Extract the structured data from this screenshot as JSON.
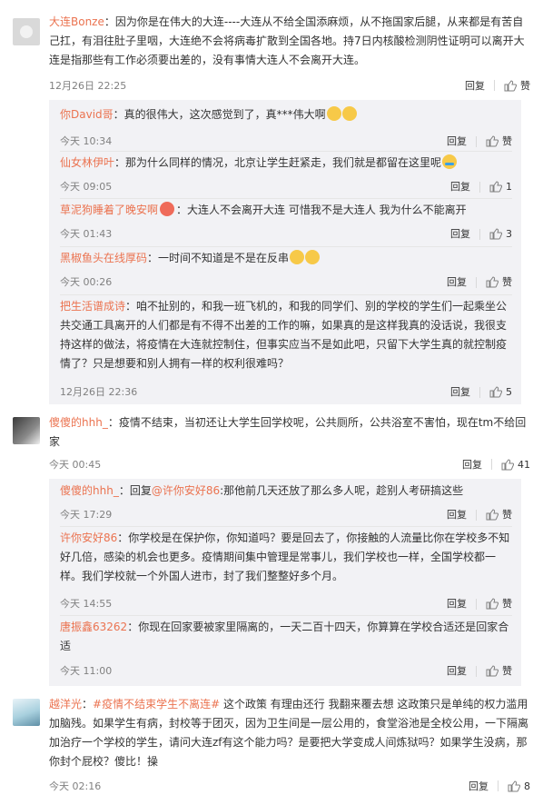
{
  "labels": {
    "reply": "回复",
    "like": "赞"
  },
  "comments": [
    {
      "user": "大连Bonze",
      "text": "：因为你是在伟大的大连----大连从不给全国添麻烦，从不拖国家后腿，从来都是有苦自己扛，有泪往肚子里咽，大连绝不会将病毒扩散到全国各地。持7日内核酸检测阴性证明可以离开大连是指那些有工作必须要出差的，没有事情大连人不会离开大连。",
      "time": "12月26日 22:25",
      "likes": "赞",
      "replies": [
        {
          "user": "你David哥",
          "text": "：真的很伟大，这次感觉到了，真***伟大啊",
          "time": "今天 10:34",
          "likes": "赞"
        },
        {
          "user": "仙女林伊叶",
          "text": "：那为什么同样的情况，北京让学生赶紧走，我们就是都留在这里呢",
          "time": "今天 09:05",
          "likes": "1"
        },
        {
          "user": "草泥狗睡着了晚安啊",
          "text": "：大连人不会离开大连 可惜我不是大连人 我为什么不能离开",
          "time": "今天 01:43",
          "likes": "3"
        },
        {
          "user": "黑椒鱼头在线厚码",
          "text": "：一时间不知道是不是在反串",
          "time": "今天 00:26",
          "likes": "赞"
        },
        {
          "user": "把生活谱成诗",
          "text": "：咱不扯别的，和我一班飞机的，和我的同学们、别的学校的学生们一起乘坐公共交通工具离开的人们都是有不得不出差的工作的嘛，如果真的是这样我真的没话说，我很支持这样的做法，将疫情在大连就控制住，但事实应当不是如此吧，只留下大学生真的就控制疫情了？只是想要和别人拥有一样的权利很难吗？",
          "time": "12月26日 22:36",
          "likes": "5"
        }
      ]
    },
    {
      "user": "傻傻的hhh_",
      "text": "：疫情不结束，当初还让大学生回学校呢，公共厕所，公共浴室不害怕，现在tm不给回家",
      "time": "今天 00:45",
      "likes": "41",
      "replies": [
        {
          "user": "傻傻的hhh_",
          "text_pre": "：回复",
          "mention": "@许你安好86",
          "text": ":那他前几天还放了那么多人呢，趁别人考研搞这些",
          "time": "今天 17:29",
          "likes": "赞"
        },
        {
          "user": "许你安好86",
          "text": "：你学校是在保护你，你知道吗？要是回去了，你接触的人流量比你在学校多不知好几倍，感染的机会也更多。疫情期间集中管理是常事儿，我们学校也一样，全国学校都一样。我们学校就一个外国人进市，封了我们整整好多个月。",
          "time": "今天 14:55",
          "likes": "赞"
        },
        {
          "user": "唐振鑫63262",
          "text": "：你现在回家要被家里隔离的，一天二百十四天，你算算在学校合适还是回家合适",
          "time": "今天 11:00",
          "likes": "赞"
        }
      ]
    },
    {
      "user": "越洋光",
      "tag": "#疫情不结束学生不离连#",
      "text": " 这个政策 有理由还行 我翻来覆去想 这政策只是单纯的权力滥用加脑残。如果学生有病，封校等于团灭，因为卫生间是一层公用的，食堂浴池是全校公用，一下隔离加治疗一个学校的学生，请问大连zf有这个能力吗？是要把大学变成人间炼狱吗？如果学生没病，那你封个屁校？傻比！操",
      "time": "今天 02:16",
      "likes": "8"
    }
  ]
}
